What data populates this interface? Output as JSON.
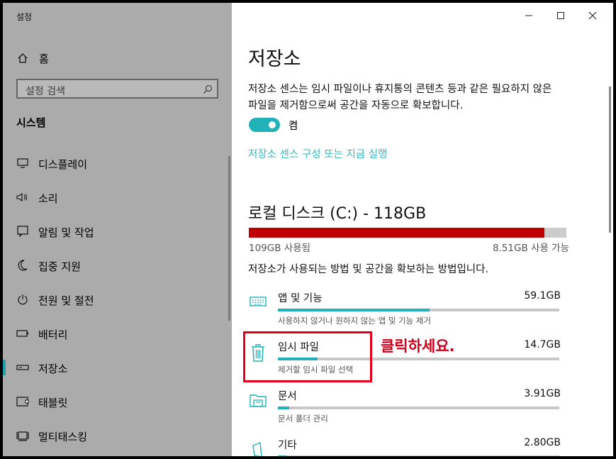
{
  "app": {
    "title": "설정"
  },
  "sidebar": {
    "home_label": "홈",
    "search_placeholder": "설정 검색",
    "section_title": "시스템",
    "items": [
      {
        "label": "디스플레이",
        "icon": "monitor-icon"
      },
      {
        "label": "소리",
        "icon": "speaker-icon"
      },
      {
        "label": "알림 및 작업",
        "icon": "notification-icon"
      },
      {
        "label": "집중 지원",
        "icon": "moon-icon"
      },
      {
        "label": "전원 및 절전",
        "icon": "power-icon"
      },
      {
        "label": "배터리",
        "icon": "battery-icon"
      },
      {
        "label": "저장소",
        "icon": "storage-icon",
        "selected": true
      },
      {
        "label": "태블릿",
        "icon": "tablet-icon"
      },
      {
        "label": "멀티태스킹",
        "icon": "multitasking-icon"
      }
    ]
  },
  "main": {
    "title": "저장소",
    "description": "저장소 센스는 임시 파일이나 휴지통의 콘텐츠 등과 같은 필요하지 않은 파일을 제거함으로써 공간을 자동으로 확보합니다.",
    "toggle": {
      "state_label": "켬",
      "on": true
    },
    "config_link": "저장소 센스 구성 또는 지금 실행",
    "disk": {
      "title": "로컬 디스크 (C:) - 118GB",
      "used_label": "109GB 사용됨",
      "free_label": "8.51GB 사용 가능",
      "used_fraction": 0.93
    },
    "explain": "저장소가 사용되는 방법 및 공간을 확보하는 방법입니다.",
    "categories": [
      {
        "name": "앱 및 기능",
        "size": "59.1GB",
        "sub": "사용하지 않거나 원하지 않는 앱 및 기능 제거",
        "fraction": 0.54,
        "icon": "keyboard-icon"
      },
      {
        "name": "임시 파일",
        "size": "14.7GB",
        "sub": "제거할 임시 파일 선택",
        "fraction": 0.14,
        "icon": "trash-icon"
      },
      {
        "name": "문서",
        "size": "3.91GB",
        "sub": "문서 폴더 관리",
        "fraction": 0.04,
        "icon": "folder-icon"
      },
      {
        "name": "기타",
        "size": "2.80GB",
        "sub": "",
        "fraction": 0.03,
        "icon": "other-icon"
      }
    ]
  },
  "annotation": {
    "text": "클릭하세요."
  },
  "colors": {
    "accent": "#20b2b8",
    "disk_used": "#c00000",
    "highlight": "#e2001a",
    "sidebar_bg": "#ababab"
  }
}
